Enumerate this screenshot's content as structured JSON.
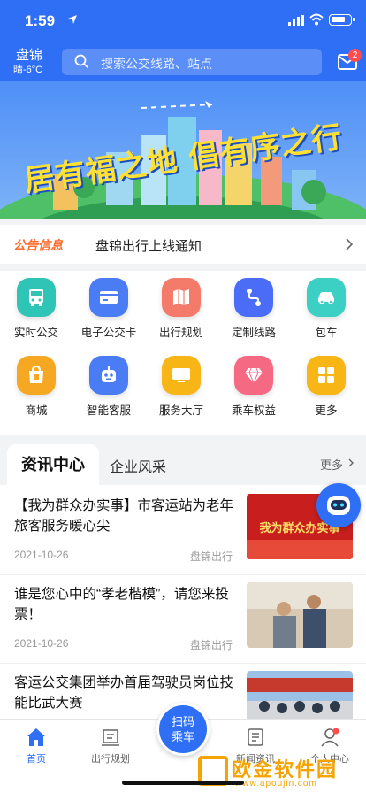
{
  "status_bar": {
    "time": "1:59"
  },
  "header": {
    "city": "盘锦",
    "weather": "晴-6°C",
    "search_placeholder": "搜索公交线路、站点",
    "mail_badge": "2"
  },
  "banner": {
    "text": "居有福之地 倡有序之行"
  },
  "notice": {
    "tag": "公告信息",
    "text": "盘锦出行上线通知"
  },
  "services": [
    {
      "label": "实时公交",
      "icon": "bus-icon",
      "color": "#2ec4b6"
    },
    {
      "label": "电子公交卡",
      "icon": "card-icon",
      "color": "#4a7cf6"
    },
    {
      "label": "出行规划",
      "icon": "map-icon",
      "color": "#f47b6a"
    },
    {
      "label": "定制线路",
      "icon": "route-icon",
      "color": "#4a6cf6"
    },
    {
      "label": "包车",
      "icon": "car-icon",
      "color": "#3ccfc4"
    },
    {
      "label": "商城",
      "icon": "shop-bag-icon",
      "color": "#f7a823"
    },
    {
      "label": "智能客服",
      "icon": "robot-icon",
      "color": "#4a7cf6"
    },
    {
      "label": "服务大厅",
      "icon": "monitor-icon",
      "color": "#f7b516"
    },
    {
      "label": "乘车权益",
      "icon": "diamond-icon",
      "color": "#f56a82"
    },
    {
      "label": "更多",
      "icon": "more-grid-icon",
      "color": "#f7b516"
    }
  ],
  "news": {
    "tabs": [
      "资讯中心",
      "企业风采"
    ],
    "more": "更多",
    "articles": [
      {
        "title": "【我为群众办实事】市客运站为老年旅客服务暖心尖",
        "date": "2021-10-26",
        "source": "盘锦出行",
        "image_caption": "我为群众办实事"
      },
      {
        "title": "谁是您心中的“孝老楷模”，请您来投票！",
        "date": "2021-10-26",
        "source": "盘锦出行"
      },
      {
        "title": "客运公交集团举办首届驾驶员岗位技能比武大赛",
        "date": "",
        "source": ""
      }
    ]
  },
  "tabbar": {
    "items": [
      "首页",
      "出行规划",
      "新闻资讯",
      "个人中心"
    ],
    "scan": [
      "扫码",
      "乘车"
    ]
  },
  "watermark": {
    "text": "欧金软件园",
    "url": "www.apoujin.com"
  },
  "colors": {
    "primary": "#2e6ff5",
    "notice_tag": "#ff6a2a"
  }
}
